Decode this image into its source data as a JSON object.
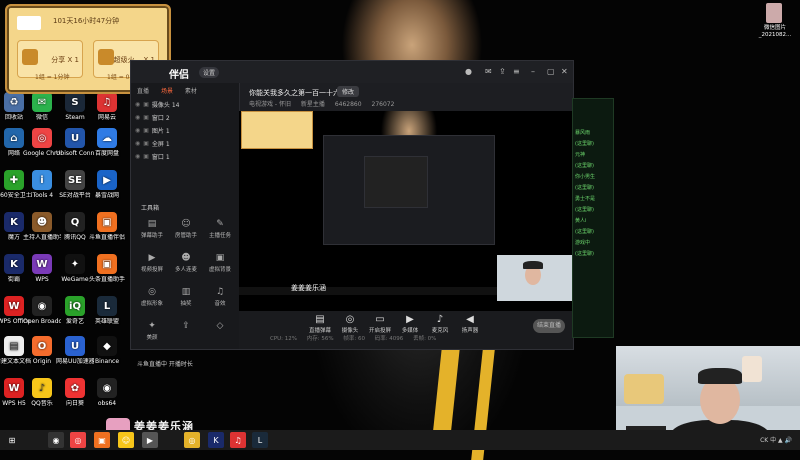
{
  "desktop_icons": [
    {
      "id": "recycle",
      "label": "回收站",
      "color": "#4a6fa5",
      "glyph": "♻",
      "icon": "recycle-bin-icon"
    },
    {
      "id": "wechat",
      "label": "微信",
      "color": "#2bb24c",
      "glyph": "✉",
      "icon": "wechat-icon"
    },
    {
      "id": "steam",
      "label": "Steam",
      "color": "#1b2838",
      "glyph": "S",
      "icon": "steam-icon"
    },
    {
      "id": "netease",
      "label": "网易云",
      "color": "#d33",
      "glyph": "♫",
      "icon": "netease-music-icon"
    },
    {
      "id": "net",
      "label": "网络",
      "color": "#2266aa",
      "glyph": "⌂",
      "icon": "network-icon"
    },
    {
      "id": "chrome",
      "label": "Google Chrome",
      "color": "#e44",
      "glyph": "◎",
      "icon": "chrome-icon"
    },
    {
      "id": "ubisoft",
      "label": "Ubisoft Connect",
      "color": "#2255aa",
      "glyph": "U",
      "icon": "ubisoft-icon"
    },
    {
      "id": "baidu",
      "label": "百度网盘",
      "color": "#2f7be5",
      "glyph": "☁",
      "icon": "baidu-netdisk-icon"
    },
    {
      "id": "360",
      "label": "360安全卫士",
      "color": "#2aa22a",
      "glyph": "✚",
      "icon": "shield-icon"
    },
    {
      "id": "itools",
      "label": "iTools 4",
      "color": "#3a8ee0",
      "glyph": "i",
      "icon": "itools-icon"
    },
    {
      "id": "wegame2",
      "label": "SE对战平台",
      "color": "#444",
      "glyph": "SE",
      "icon": "se-platform-icon"
    },
    {
      "id": "tencent",
      "label": "暴雪战网",
      "color": "#1a64c8",
      "glyph": "▶",
      "icon": "battlenet-icon"
    },
    {
      "id": "dota",
      "label": "魔方",
      "color": "#1a2a6a",
      "glyph": "K",
      "icon": "game-icon"
    },
    {
      "id": "host",
      "label": "主持人直播助手",
      "color": "#8a5a2a",
      "glyph": "☻",
      "icon": "host-assistant-icon"
    },
    {
      "id": "qq",
      "label": "腾讯QQ",
      "color": "#222",
      "glyph": "Q",
      "icon": "qq-icon"
    },
    {
      "id": "toutiao",
      "label": "斗鱼直播伴侣",
      "color": "#f07020",
      "glyph": "▣",
      "icon": "douyu-icon"
    },
    {
      "id": "kof",
      "label": "街霸",
      "color": "#1a2a6a",
      "glyph": "K",
      "icon": "game-icon"
    },
    {
      "id": "wps",
      "label": "WPS",
      "color": "#7a3ab8",
      "glyph": "W",
      "icon": "video-icon"
    },
    {
      "id": "wegame",
      "label": "WeGame",
      "color": "#111",
      "glyph": "✦",
      "icon": "wegame-icon"
    },
    {
      "id": "dy",
      "label": "头条直播助手",
      "color": "#f07020",
      "glyph": "▣",
      "icon": "broadcast-icon"
    },
    {
      "id": "wpsoffice",
      "label": "WPS Office",
      "color": "#d22",
      "glyph": "W",
      "icon": "wps-office-icon"
    },
    {
      "id": "obs",
      "label": "Open Broadcast...",
      "color": "#222",
      "glyph": "◉",
      "icon": "obs-icon"
    },
    {
      "id": "iqiyi",
      "label": "爱奇艺",
      "color": "#2aa22a",
      "glyph": "iQ",
      "icon": "iqiyi-icon"
    },
    {
      "id": "lol",
      "label": "英雄联盟",
      "color": "#1a2a3a",
      "glyph": "L",
      "icon": "lol-icon"
    },
    {
      "id": "newdoc",
      "label": "新建文本文档 (5)",
      "color": "#eee",
      "glyph": "▤",
      "icon": "text-file-icon"
    },
    {
      "id": "origin",
      "label": "Origin",
      "color": "#f56c2d",
      "glyph": "O",
      "icon": "origin-icon"
    },
    {
      "id": "uu",
      "label": "网易UU加速器",
      "color": "#2a62d0",
      "glyph": "U",
      "icon": "uu-booster-icon"
    },
    {
      "id": "binance",
      "label": "Binance",
      "color": "#111",
      "glyph": "◆",
      "icon": "binance-icon"
    },
    {
      "id": "wps5",
      "label": "WPS H5",
      "color": "#d22",
      "glyph": "W",
      "icon": "wps-h5-icon"
    },
    {
      "id": "qqmusic",
      "label": "QQ音乐",
      "color": "#f7c61a",
      "glyph": "♪",
      "icon": "qq-music-icon"
    },
    {
      "id": "xiangyue",
      "label": "向日葵",
      "color": "#e33",
      "glyph": "✿",
      "icon": "sunflower-icon"
    },
    {
      "id": "obs64",
      "label": "obs64",
      "color": "#222",
      "glyph": "◉",
      "icon": "obs-icon"
    },
    {
      "id": "dybox",
      "label": "头条直播盒子",
      "color": "#f7c61a",
      "glyph": "☺",
      "icon": "live-box-icon"
    },
    {
      "id": "kuaishou",
      "label": "快抖屏",
      "color": "#f7c61a",
      "glyph": "▷",
      "icon": "kuaishou-icon"
    },
    {
      "id": "doc2",
      "label": "新建文本文档",
      "color": "#eee",
      "glyph": "▤",
      "icon": "text-file-icon"
    },
    {
      "id": "bkp",
      "label": "原神",
      "color": "#e4b22a",
      "glyph": "◈",
      "icon": "game-icon"
    },
    {
      "id": "pm",
      "label": "PDF",
      "color": "#eee",
      "glyph": "▤",
      "icon": "pdf-icon"
    },
    {
      "id": "dyb",
      "label": "新建文本文档 (4)",
      "color": "#eee",
      "glyph": "▤",
      "icon": "text-file-icon"
    }
  ],
  "card": {
    "header": "101天16小时47分钟",
    "slot1_text": "分享 X 1",
    "slot2_text": "超级火... X 1",
    "slot1_cost": "1组 = 1分钟",
    "slot2_cost": "1组 = 0.01分钟"
  },
  "window": {
    "brand": "伴侣",
    "chip": "设置",
    "left_tabs": [
      "直播",
      "场景",
      "素材"
    ],
    "sources": [
      "摄像头 14",
      "窗口 2",
      "图片 1",
      "全屏 1",
      "窗口 1"
    ],
    "tools_title": "工具箱",
    "tools": [
      {
        "label": "弹幕助手",
        "glyph": "▤",
        "icon": "danmaku-icon"
      },
      {
        "label": "房管助手",
        "glyph": "☺",
        "icon": "room-admin-icon"
      },
      {
        "label": "主播任务",
        "glyph": "✎",
        "icon": "task-icon"
      },
      {
        "label": "视频投屏",
        "glyph": "▶",
        "icon": "video-cast-icon"
      },
      {
        "label": "多人连麦",
        "glyph": "☻",
        "icon": "multi-mic-icon"
      },
      {
        "label": "虚拟背景",
        "glyph": "▣",
        "icon": "virtual-bg-icon"
      },
      {
        "label": "虚拟形象",
        "glyph": "◎",
        "icon": "avatar-icon"
      },
      {
        "label": "抽奖",
        "glyph": "▥",
        "icon": "lottery-icon"
      },
      {
        "label": "音效",
        "glyph": "♫",
        "icon": "sound-effect-icon"
      },
      {
        "label": "美颜",
        "glyph": "✦",
        "icon": "beauty-icon"
      },
      {
        "label": "",
        "glyph": "⇪",
        "icon": "share-icon"
      },
      {
        "label": "",
        "glyph": "◇",
        "icon": "more-icon"
      }
    ],
    "notice": "斗鱼直播中 开播时长",
    "stream_title": "你能关我多久之第一百一十六天!",
    "pill": "修改",
    "meta": [
      "电视游戏 - 怀旧",
      "新星主播",
      "6462860",
      "276072"
    ],
    "bottom_buttons": [
      {
        "label": "直播弹幕",
        "glyph": "▤",
        "icon": "danmaku-icon"
      },
      {
        "label": "摄像头",
        "glyph": "◎",
        "icon": "camera-icon"
      },
      {
        "label": "开启投屏",
        "glyph": "▭",
        "icon": "screencast-icon"
      },
      {
        "label": "多媒体",
        "glyph": "▶",
        "icon": "media-icon"
      },
      {
        "label": "麦克风",
        "glyph": "♪",
        "icon": "microphone-icon"
      },
      {
        "label": "扬声器",
        "glyph": "◀",
        "icon": "speaker-icon"
      }
    ],
    "start_label": "结束直播",
    "status": [
      "CPU: 12%",
      "内存: 56%",
      "帧率: 60",
      "码率: 4096",
      "丢帧: 0%"
    ]
  },
  "chat_lines": [
    "暴风雨",
    "(这里聊)",
    "元神",
    "(这里聊)",
    "你小男生",
    "(这里聊)",
    "勇士不是",
    "(这里聊)",
    "黄人i",
    "(这里聊)",
    "游戏中",
    "(这里聊)"
  ],
  "watermark": "姜姜姜乐涵",
  "avatar_label": "微信图片_2021082...",
  "taskbar": {
    "items": [
      {
        "glyph": "⊞",
        "color": "#1b1b1b",
        "icon": "windows-start-icon"
      },
      {
        "glyph": "◉",
        "color": "#333",
        "icon": "steam-icon"
      },
      {
        "glyph": "◎",
        "color": "#e44",
        "icon": "chrome-icon"
      },
      {
        "glyph": "▣",
        "color": "#f07020",
        "icon": "douyu-icon"
      },
      {
        "glyph": "☺",
        "color": "#f7c61a",
        "icon": "live-box-icon"
      },
      {
        "glyph": "▶",
        "color": "#555",
        "icon": "media-icon"
      },
      {
        "glyph": "◎",
        "color": "#e4b22a",
        "icon": "game-icon"
      },
      {
        "glyph": "K",
        "color": "#1a2a6a",
        "icon": "game-icon"
      },
      {
        "glyph": "♫",
        "color": "#d33",
        "icon": "netease-music-icon"
      },
      {
        "glyph": "L",
        "color": "#1a2a3a",
        "icon": "lol-icon"
      }
    ],
    "tray": "CK 中 ▲ 🔊"
  }
}
